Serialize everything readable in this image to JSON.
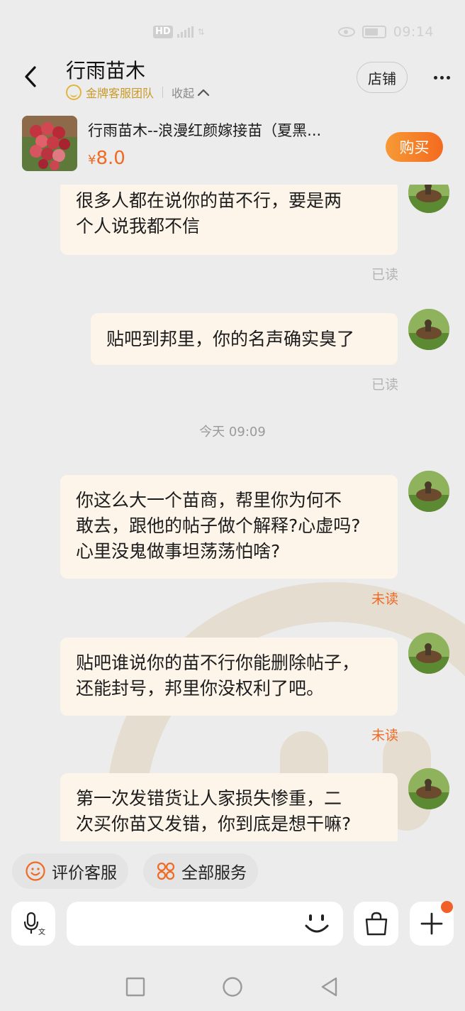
{
  "status_bar": {
    "network": "HD",
    "time": "09:14"
  },
  "header": {
    "title": "行雨苗木",
    "gold_service": "金牌客服团队",
    "collapse": "收起",
    "store_button": "店铺"
  },
  "product": {
    "title": "行雨苗木--浪漫红颜嫁接苗（夏黑...",
    "currency": "¥",
    "price": "8.0",
    "buy_button": "购买"
  },
  "messages": [
    {
      "text_lines": [
        "很多人都在说你的苗不行，要是两",
        "个人说我都不信"
      ],
      "status": "已读"
    },
    {
      "text_lines": [
        "贴吧到邦里，你的名声确实臭了"
      ],
      "status": "已读"
    },
    {
      "text_lines": [
        "你这么大一个苗商，帮里你为何不",
        "敢去，跟他的帖子做个解释?心虚吗?",
        "心里没鬼做事坦荡荡怕啥?"
      ],
      "status": "未读"
    },
    {
      "text_lines": [
        "贴吧谁说你的苗不行你能删除帖子，",
        "还能封号，邦里你没权利了吧。"
      ],
      "status": "未读"
    },
    {
      "text_lines": [
        "第一次发错货让人家损失惨重，二",
        "次买你苗又发错，你到底是想干嘛?"
      ],
      "status": ""
    }
  ],
  "time_separator": "今天  09:09",
  "quick_actions": {
    "rate_service": "评价客服",
    "all_services": "全部服务"
  },
  "input": {
    "placeholder": ""
  },
  "colors": {
    "accent": "#f06a24",
    "bubble": "#fdf5ea",
    "gold": "#c79a2b"
  }
}
